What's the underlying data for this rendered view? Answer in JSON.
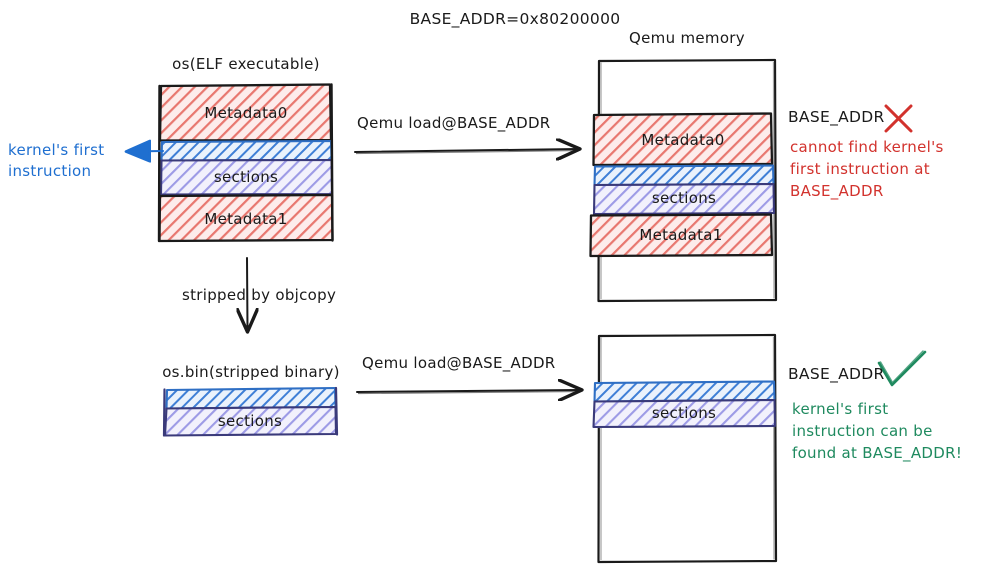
{
  "diagram": {
    "title": "BASE_ADDR=0x80200000",
    "colors": {
      "metadata_fill": "#e8776f",
      "metadata_stroke": "#1a1a1a",
      "first_instruction_fill": "#3f7fd6",
      "sections_fill": "#7a78d8",
      "sections_stroke": "#3a3a7a",
      "error_red": "#d2322d",
      "success_green": "#1f8a5f",
      "annotation_blue": "#1f6fd0",
      "box_stroke": "#1a1a1a"
    },
    "left_top": {
      "caption": "os(ELF executable)",
      "blocks": [
        {
          "label": "Metadata0",
          "kind": "metadata"
        },
        {
          "label": "",
          "kind": "first-instruction"
        },
        {
          "label": "sections",
          "kind": "sections"
        },
        {
          "label": "Metadata1",
          "kind": "metadata"
        }
      ]
    },
    "left_annotation": {
      "line1": "kernel's first",
      "line2": "instruction"
    },
    "arrow_top": {
      "label": "Qemu load@BASE_ADDR"
    },
    "arrow_bottom": {
      "label": "Qemu load@BASE_ADDR"
    },
    "strip_arrow": {
      "label": "stripped by objcopy"
    },
    "left_bottom": {
      "caption": "os.bin(stripped binary)",
      "blocks": [
        {
          "label": "",
          "kind": "first-instruction"
        },
        {
          "label": "sections",
          "kind": "sections"
        }
      ]
    },
    "memory_top": {
      "caption": "Qemu memory",
      "blocks": [
        {
          "label": "Metadata0",
          "kind": "metadata"
        },
        {
          "label": "",
          "kind": "first-instruction"
        },
        {
          "label": "sections",
          "kind": "sections"
        },
        {
          "label": "Metadata1",
          "kind": "metadata"
        }
      ]
    },
    "memory_bottom": {
      "blocks": [
        {
          "label": "",
          "kind": "first-instruction"
        },
        {
          "label": "sections",
          "kind": "sections"
        }
      ]
    },
    "annotation_fail": {
      "addr": "BASE_ADDR",
      "mark": "cross-mark-icon",
      "line1": "cannot find kernel's",
      "line2": "first instruction at",
      "line3": "BASE_ADDR"
    },
    "annotation_success": {
      "addr": "BASE_ADDR",
      "mark": "check-mark-icon",
      "line1": "kernel's first",
      "line2": "instruction can be",
      "line3": "found at BASE_ADDR!"
    }
  }
}
